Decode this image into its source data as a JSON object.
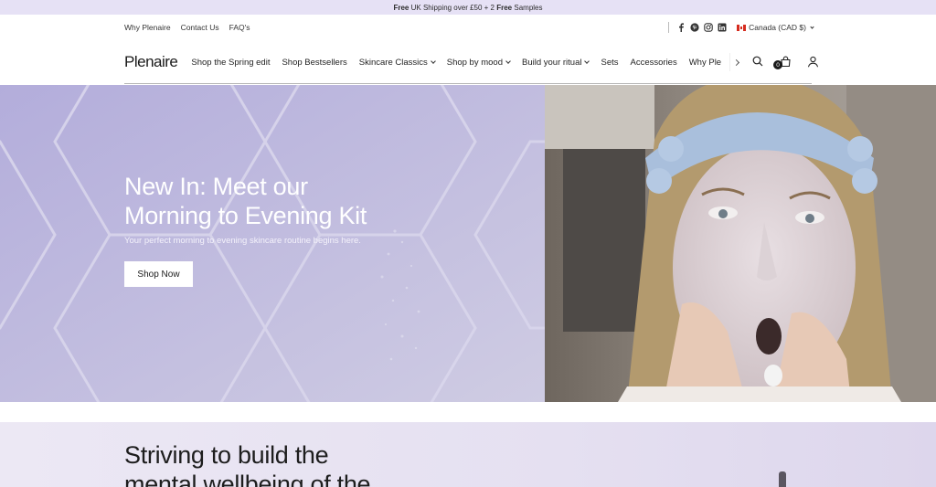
{
  "announcement": {
    "part1_bold": "Free",
    "part2": " UK Shipping over £50 + 2 ",
    "part3_bold": "Free",
    "part4": " Samples"
  },
  "utility": {
    "links": [
      "Why Plenaire",
      "Contact Us",
      "FAQ's"
    ],
    "social_icons": [
      "facebook-icon",
      "pinterest-icon",
      "instagram-icon",
      "linkedin-icon"
    ],
    "country": "Canada (CAD $)"
  },
  "nav": {
    "logo": "Plenaire",
    "items": [
      {
        "label": "Shop the Spring edit",
        "has_dropdown": false
      },
      {
        "label": "Shop Bestsellers",
        "has_dropdown": false
      },
      {
        "label": "Skincare Classics",
        "has_dropdown": true
      },
      {
        "label": "Shop by mood",
        "has_dropdown": true
      },
      {
        "label": "Build your ritual",
        "has_dropdown": true
      },
      {
        "label": "Sets",
        "has_dropdown": false
      },
      {
        "label": "Accessories",
        "has_dropdown": false
      },
      {
        "label": "Why Plenaire",
        "has_dropdown": false
      }
    ],
    "cart_count": "0"
  },
  "hero": {
    "title_line1": "New In: Meet our",
    "title_line2": "Morning to Evening Kit",
    "subtitle": "Your perfect morning to evening skincare routine begins here.",
    "cta": "Shop Now"
  },
  "lower": {
    "title_line1": "Striving to build the",
    "title_line2": "mental wellbeing of the"
  },
  "colors": {
    "announce_bg": "#e6e1f5",
    "hero_lavender": "#bdb8db",
    "text_dark": "#1f1f1f"
  }
}
